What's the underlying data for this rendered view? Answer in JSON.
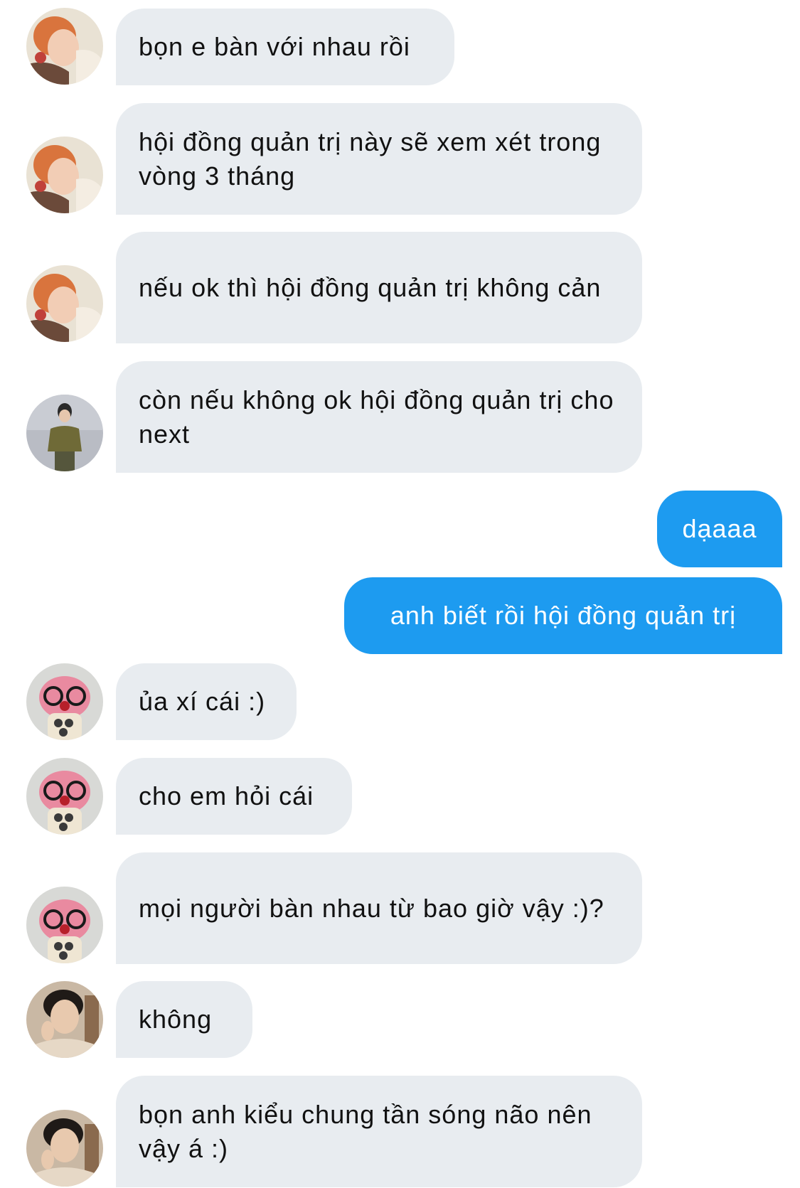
{
  "colors": {
    "incoming_bubble": "#E8ECF0",
    "outgoing_bubble": "#1D9BF0",
    "incoming_text": "#111111",
    "outgoing_text": "#FFFFFF"
  },
  "messages": [
    {
      "sender": "user-red-hair",
      "direction": "incoming",
      "text": "bọn e bàn với nhau rồi"
    },
    {
      "sender": "user-red-hair",
      "direction": "incoming",
      "text": "hội đồng quản trị này sẽ xem xét trong vòng 3 tháng"
    },
    {
      "sender": "user-red-hair",
      "direction": "incoming",
      "text": "nếu ok thì hội đồng quản trị không cản"
    },
    {
      "sender": "user-olive-shirt",
      "direction": "incoming",
      "text": "còn nếu không ok hội đồng quản trị cho next"
    },
    {
      "sender": "me",
      "direction": "outgoing",
      "text": "dạaaa"
    },
    {
      "sender": "me",
      "direction": "outgoing",
      "text": "anh biết rồi hội đồng quản trị"
    },
    {
      "sender": "user-pink-plush",
      "direction": "incoming",
      "text": "ủa xí cái :)"
    },
    {
      "sender": "user-pink-plush",
      "direction": "incoming",
      "text": "cho em hỏi cái"
    },
    {
      "sender": "user-pink-plush",
      "direction": "incoming",
      "text": "mọi người bàn nhau từ bao giờ vậy :)?"
    },
    {
      "sender": "user-dark-hair",
      "direction": "incoming",
      "text": "không"
    },
    {
      "sender": "user-dark-hair",
      "direction": "incoming",
      "text": "bọn anh kiểu chung tần sóng não nên vậy á :)"
    }
  ]
}
